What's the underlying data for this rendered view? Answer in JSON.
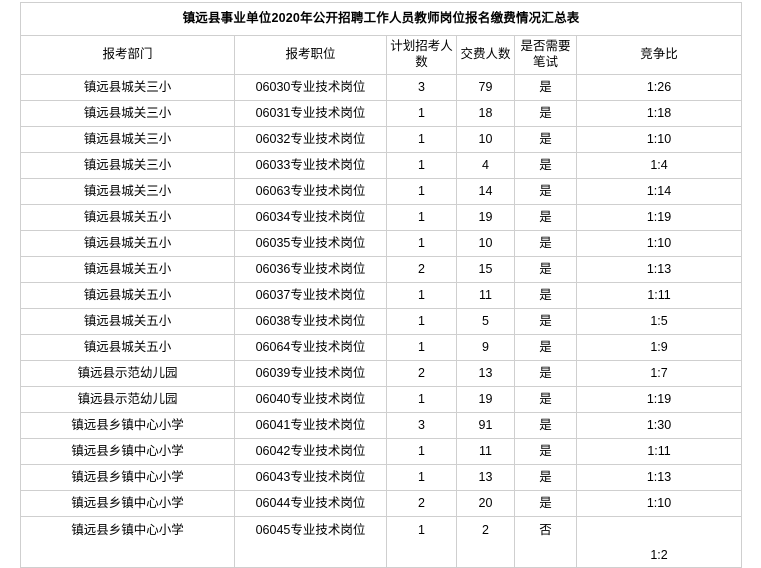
{
  "document": {
    "title": "镇远县事业单位2020年公开招聘工作人员教师岗位报名缴费情况汇总表",
    "columns": [
      "报考部门",
      "报考职位",
      "计划招考人数",
      "交费人数",
      "是否需要笔试",
      "竞争比"
    ],
    "rows": [
      {
        "dept": "镇远县城关三小",
        "position": "06030专业技术岗位",
        "plan": "3",
        "paid": "79",
        "exam": "是",
        "ratio": "1:26"
      },
      {
        "dept": "镇远县城关三小",
        "position": "06031专业技术岗位",
        "plan": "1",
        "paid": "18",
        "exam": "是",
        "ratio": "1:18"
      },
      {
        "dept": "镇远县城关三小",
        "position": "06032专业技术岗位",
        "plan": "1",
        "paid": "10",
        "exam": "是",
        "ratio": "1:10"
      },
      {
        "dept": "镇远县城关三小",
        "position": "06033专业技术岗位",
        "plan": "1",
        "paid": "4",
        "exam": "是",
        "ratio": "1:4"
      },
      {
        "dept": "镇远县城关三小",
        "position": "06063专业技术岗位",
        "plan": "1",
        "paid": "14",
        "exam": "是",
        "ratio": "1:14"
      },
      {
        "dept": "镇远县城关五小",
        "position": "06034专业技术岗位",
        "plan": "1",
        "paid": "19",
        "exam": "是",
        "ratio": "1:19"
      },
      {
        "dept": "镇远县城关五小",
        "position": "06035专业技术岗位",
        "plan": "1",
        "paid": "10",
        "exam": "是",
        "ratio": "1:10"
      },
      {
        "dept": "镇远县城关五小",
        "position": "06036专业技术岗位",
        "plan": "2",
        "paid": "15",
        "exam": "是",
        "ratio": "1:13"
      },
      {
        "dept": "镇远县城关五小",
        "position": "06037专业技术岗位",
        "plan": "1",
        "paid": "11",
        "exam": "是",
        "ratio": "1:11"
      },
      {
        "dept": "镇远县城关五小",
        "position": "06038专业技术岗位",
        "plan": "1",
        "paid": "5",
        "exam": "是",
        "ratio": "1:5"
      },
      {
        "dept": "镇远县城关五小",
        "position": "06064专业技术岗位",
        "plan": "1",
        "paid": "9",
        "exam": "是",
        "ratio": "1:9"
      },
      {
        "dept": "镇远县示范幼儿园",
        "position": "06039专业技术岗位",
        "plan": "2",
        "paid": "13",
        "exam": "是",
        "ratio": "1:7"
      },
      {
        "dept": "镇远县示范幼儿园",
        "position": "06040专业技术岗位",
        "plan": "1",
        "paid": "19",
        "exam": "是",
        "ratio": "1:19"
      },
      {
        "dept": "镇远县乡镇中心小学",
        "position": "06041专业技术岗位",
        "plan": "3",
        "paid": "91",
        "exam": "是",
        "ratio": "1:30"
      },
      {
        "dept": "镇远县乡镇中心小学",
        "position": "06042专业技术岗位",
        "plan": "1",
        "paid": "11",
        "exam": "是",
        "ratio": "1:11"
      },
      {
        "dept": "镇远县乡镇中心小学",
        "position": "06043专业技术岗位",
        "plan": "1",
        "paid": "13",
        "exam": "是",
        "ratio": "1:13"
      },
      {
        "dept": "镇远县乡镇中心小学",
        "position": "06044专业技术岗位",
        "plan": "2",
        "paid": "20",
        "exam": "是",
        "ratio": "1:10"
      },
      {
        "dept": "镇远县乡镇中心小学",
        "position": "06045专业技术岗位",
        "plan": "1",
        "paid": "2",
        "exam": "否",
        "ratio": "1:2"
      }
    ]
  }
}
